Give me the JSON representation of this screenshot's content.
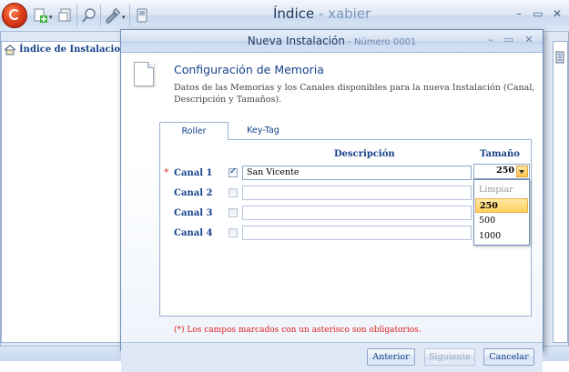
{
  "app": {
    "title": "Índice",
    "title_sep": " - ",
    "user": "xabier",
    "controls": {
      "minimize": "–",
      "maximize": "▭",
      "close": "✕"
    }
  },
  "left_pane": {
    "tab_label": "Índice de Instalaciones"
  },
  "dialog": {
    "title": "Nueva Instalación",
    "number": "Número 0001",
    "heading": "Configuración de Memoria",
    "description": "Datos de las Memorias y los Canales disponibles para la nueva Instalación (Canal, Descripción y Tamaños).",
    "tabs": [
      {
        "label": "Roller",
        "active": true
      },
      {
        "label": "Key-Tag",
        "active": false
      }
    ],
    "columns": {
      "description": "Descripción",
      "size": "Tamaño"
    },
    "channels": [
      {
        "label": "Canal 1",
        "required": "*",
        "checked": true,
        "description": "San Vicente"
      },
      {
        "label": "Canal 2",
        "required": "",
        "checked": false,
        "description": ""
      },
      {
        "label": "Canal 3",
        "required": "",
        "checked": false,
        "description": ""
      },
      {
        "label": "Canal 4",
        "required": "",
        "checked": false,
        "description": ""
      }
    ],
    "size_select": {
      "value": "250",
      "options": [
        "Limpiar",
        "250",
        "500",
        "1000"
      ],
      "highlighted": "250"
    },
    "required_note": "(*) Los campos marcados con un asterisco son obligatorios.",
    "buttons": {
      "previous": "Anterior",
      "next": "Siguiente",
      "cancel": "Cancelar"
    }
  },
  "colors": {
    "accent": "#15428b",
    "required": "#e02020",
    "highlight": "#ffcf5a",
    "ribbon": "#dbe6f4"
  }
}
